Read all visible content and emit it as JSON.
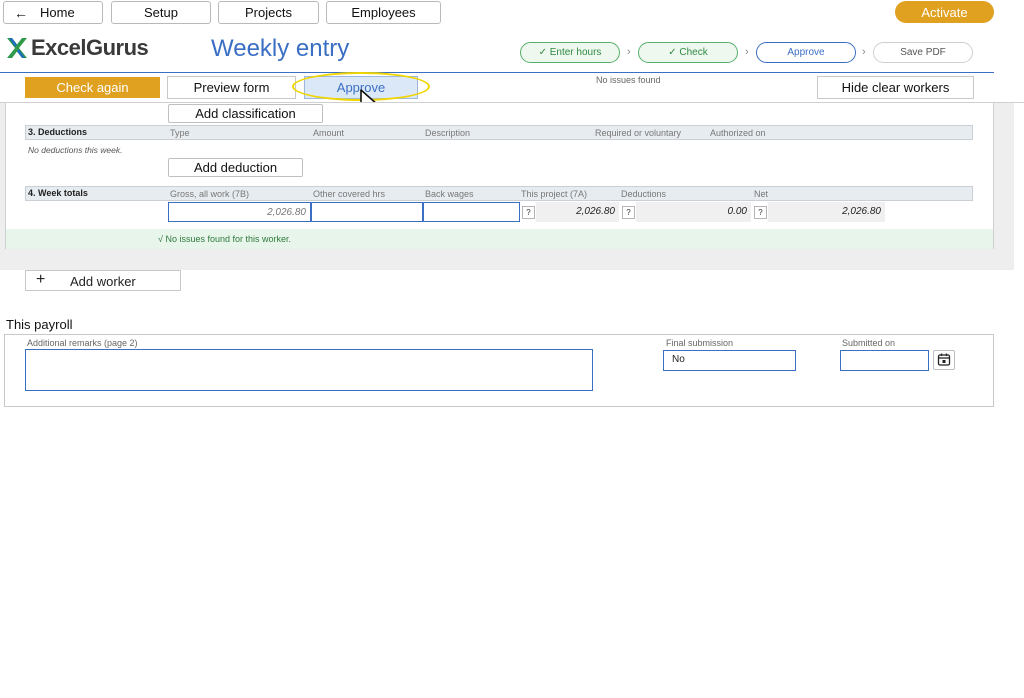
{
  "nav": {
    "home": "Home",
    "setup": "Setup",
    "projects": "Projects",
    "employees": "Employees",
    "activate": "Activate"
  },
  "brand": {
    "name": "ExcelGurus"
  },
  "page": {
    "title": "Weekly entry"
  },
  "steps": [
    {
      "label": "✓ Enter hours",
      "state": "done"
    },
    {
      "label": "✓ Check",
      "state": "done"
    },
    {
      "label": "Approve",
      "state": "active"
    },
    {
      "label": "Save PDF",
      "state": "todo"
    }
  ],
  "step_separator": "›",
  "toolbar": {
    "check_again": "Check again",
    "preview_form": "Preview form",
    "approve": "Approve",
    "status": "No issues found",
    "hide_clear_workers": "Hide clear workers"
  },
  "worker": {
    "add_classification": "Add classification",
    "deductions": {
      "title": "3. Deductions",
      "columns": [
        "Type",
        "Amount",
        "Description",
        "Required or voluntary",
        "Authorized on"
      ],
      "empty_text": "No deductions this week.",
      "add_button": "Add deduction"
    },
    "totals": {
      "title": "4. Week totals",
      "columns": [
        "Gross, all work (7B)",
        "Other covered hrs",
        "Back wages",
        "This project (7A)",
        "Deductions",
        "Net"
      ],
      "gross": "2,026.80",
      "other_hours": "",
      "back_wages": "",
      "this_project": "2,026.80",
      "deductions": "0.00",
      "net": "2,026.80",
      "help": "?"
    },
    "status": "√  No issues found for this worker."
  },
  "add_worker": {
    "icon": "+",
    "label": "Add worker"
  },
  "payroll": {
    "title": "This payroll",
    "remarks_label": "Additional remarks (page 2)",
    "remarks_value": "",
    "final_label": "Final submission",
    "final_value": "No",
    "submitted_label": "Submitted on",
    "submitted_value": ""
  },
  "colors": {
    "accent": "#3b6fc4",
    "brand_orange": "#e0a020",
    "success": "#57b06a",
    "highlight": "#f1d500"
  }
}
